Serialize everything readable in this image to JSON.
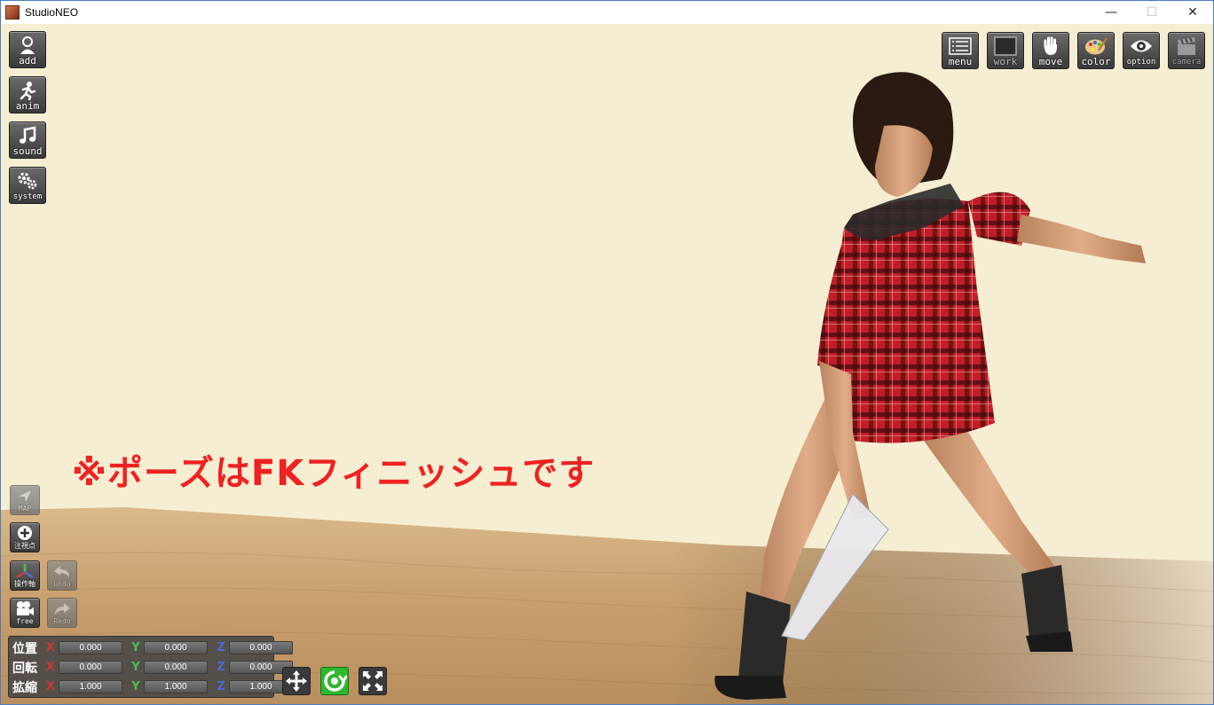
{
  "window": {
    "title": "StudioNEO",
    "minimize": "—",
    "maximize": "☐",
    "close": "✕"
  },
  "left_toolbar": [
    {
      "label": "add",
      "icon": "person-add-icon"
    },
    {
      "label": "anim",
      "icon": "running-figure-icon"
    },
    {
      "label": "sound",
      "icon": "music-note-icon"
    },
    {
      "label": "system",
      "icon": "gears-icon"
    }
  ],
  "top_toolbar": [
    {
      "label": "menu",
      "icon": "list-icon",
      "enabled": true
    },
    {
      "label": "work",
      "icon": "frame-icon",
      "enabled": true
    },
    {
      "label": "move",
      "icon": "hand-icon",
      "enabled": true
    },
    {
      "label": "color",
      "icon": "palette-icon",
      "enabled": true
    },
    {
      "label": "option",
      "icon": "eye-icon",
      "enabled": true
    },
    {
      "label": "camera",
      "icon": "clapperboard-icon",
      "enabled": false
    }
  ],
  "bottom_left_tools": {
    "map": "MAP",
    "focus": "注視点",
    "axis": "操作軸",
    "undo": "undo",
    "camera_mode": "free",
    "redo": "Redo"
  },
  "transform": {
    "rows": [
      {
        "label": "位置",
        "x": "0.000",
        "y": "0.000",
        "z": "0.000"
      },
      {
        "label": "回転",
        "x": "0.000",
        "y": "0.000",
        "z": "0.000"
      },
      {
        "label": "拡縮",
        "x": "1.000",
        "y": "1.000",
        "z": "1.000"
      }
    ],
    "axis_labels": {
      "x": "X",
      "y": "Y",
      "z": "Z"
    }
  },
  "gizmo_modes": [
    {
      "name": "move-gizmo",
      "active": false
    },
    {
      "name": "rotate-gizmo",
      "active": true
    },
    {
      "name": "scale-gizmo",
      "active": false
    }
  ],
  "caption": "※ポーズはFKフィニッシュです",
  "colors": {
    "caption": "#ee2222",
    "active_gizmo": "#2fb82f",
    "sky": "#f6eed2",
    "floor": "#c9a476"
  }
}
